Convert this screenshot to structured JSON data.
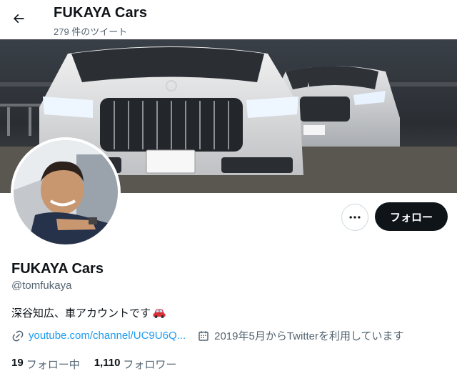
{
  "header": {
    "title": "FUKAYA Cars",
    "tweet_count": "279 件のツイート",
    "back_icon": "arrow-left-icon"
  },
  "profile": {
    "name": "FUKAYA Cars",
    "handle": "@tomfukaya",
    "bio": "深谷知広、車アカウントです",
    "bio_emoji": "car-emoji",
    "link_text": "youtube.com/channel/UC9U6Q...",
    "joined": "2019年5月からTwitterを利用しています"
  },
  "actions": {
    "more_icon": "more-dots-icon",
    "follow_label": "フォロー"
  },
  "stats": {
    "following_count": "19",
    "following_label": "フォロー中",
    "followers_count": "1,110",
    "followers_label": "フォロワー"
  },
  "colors": {
    "accent": "#1d9bf0",
    "text": "#0f1419",
    "muted": "#536471",
    "button_dark": "#0f1419"
  }
}
